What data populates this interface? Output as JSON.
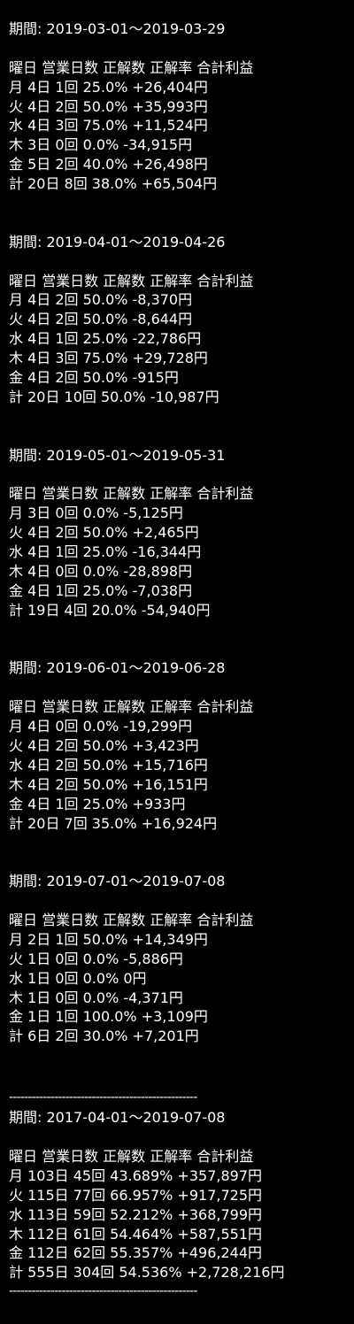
{
  "periods": [
    {
      "period_line": "期間: 2019-03-01〜2019-03-29",
      "header": "曜日 営業日数 正解数 正解率 合計利益",
      "rows": [
        "月 4日 1回 25.0% +26,404円",
        "火 4日 2回 50.0% +35,993円",
        "水 4日 3回 75.0% +11,524円",
        "木 3日 0回 0.0% -34,915円",
        "金 5日 2回 40.0% +26,498円",
        "計 20日 8回 38.0% +65,504円"
      ]
    },
    {
      "period_line": "期間: 2019-04-01〜2019-04-26",
      "header": "曜日 営業日数 正解数 正解率 合計利益",
      "rows": [
        "月 4日 2回 50.0% -8,370円",
        "火 4日 2回 50.0% -8,644円",
        "水 4日 1回 25.0% -22,786円",
        "木 4日 3回 75.0% +29,728円",
        "金 4日 2回 50.0% -915円",
        "計 20日 10回 50.0% -10,987円"
      ]
    },
    {
      "period_line": "期間: 2019-05-01〜2019-05-31",
      "header": "曜日 営業日数 正解数 正解率 合計利益",
      "rows": [
        "月 3日 0回 0.0% -5,125円",
        "火 4日 2回 50.0% +2,465円",
        "水 4日 1回 25.0% -16,344円",
        "木 4日 0回 0.0% -28,898円",
        "金 4日 1回 25.0% -7,038円",
        "計 19日 4回 20.0% -54,940円"
      ]
    },
    {
      "period_line": "期間: 2019-06-01〜2019-06-28",
      "header": "曜日 営業日数 正解数 正解率 合計利益",
      "rows": [
        "月 4日 0回 0.0% -19,299円",
        "火 4日 2回 50.0% +3,423円",
        "水 4日 2回 50.0% +15,716円",
        "木 4日 2回 50.0% +16,151円",
        "金 4日 1回 25.0% +933円",
        "計 20日 7回 35.0% +16,924円"
      ]
    },
    {
      "period_line": "期間: 2019-07-01〜2019-07-08",
      "header": "曜日 営業日数 正解数 正解率 合計利益",
      "rows": [
        "月 2日 1回 50.0% +14,349円",
        "火 1日 0回 0.0% -5,886円",
        "水 1日 0回 0.0% 0円",
        "木 1日 0回 0.0% -4,371円",
        "金 1日 1回 100.0% +3,109円",
        "計 6日 2回 30.0% +7,201円"
      ]
    }
  ],
  "separator": "--------------------------------------------------",
  "total": {
    "period_line": "期間: 2017-04-01〜2019-07-08",
    "header": "曜日 営業日数 正解数 正解率 合計利益",
    "rows": [
      "月 103日 45回 43.689% +357,897円",
      "火 115日 77回 66.957% +917,725円",
      "水 113日 59回 52.212% +368,799円",
      "木 112日 61回 54.464% +587,551円",
      "金 112日 62回 55.357% +496,244円",
      "計 555日 304回 54.536% +2,728,216円"
    ]
  },
  "colors": {
    "background": "#000000",
    "text": "#ffffff"
  }
}
